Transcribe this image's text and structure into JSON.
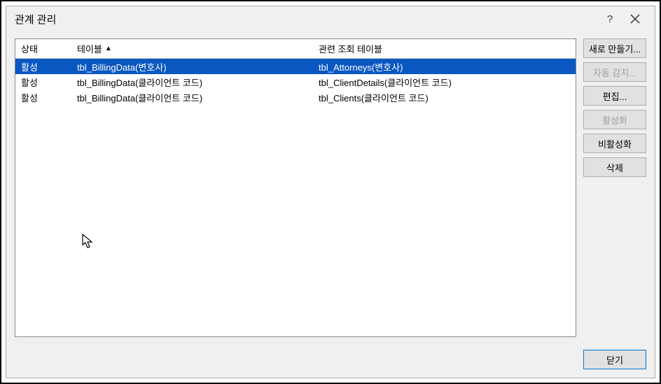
{
  "dialog": {
    "title": "관계 관리",
    "help_label": "?",
    "close_label": "×"
  },
  "columns": {
    "status": "상태",
    "table": "테이블",
    "related": "관련 조회 테이블"
  },
  "rows": [
    {
      "status": "활성",
      "table": "tbl_BillingData(변호사)",
      "related": "tbl_Attorneys(변호사)",
      "selected": true
    },
    {
      "status": "활성",
      "table": "tbl_BillingData(클라이언트 코드)",
      "related": "tbl_ClientDetails(클라이언트 코드)",
      "selected": false
    },
    {
      "status": "활성",
      "table": "tbl_BillingData(클라이언트 코드)",
      "related": "tbl_Clients(클라이언트 코드)",
      "selected": false
    }
  ],
  "buttons": {
    "new": "새로 만들기...",
    "autodetect": "자동 감지...",
    "edit": "편집...",
    "activate": "활성화",
    "deactivate": "비활성화",
    "delete": "삭제",
    "close": "닫기"
  }
}
